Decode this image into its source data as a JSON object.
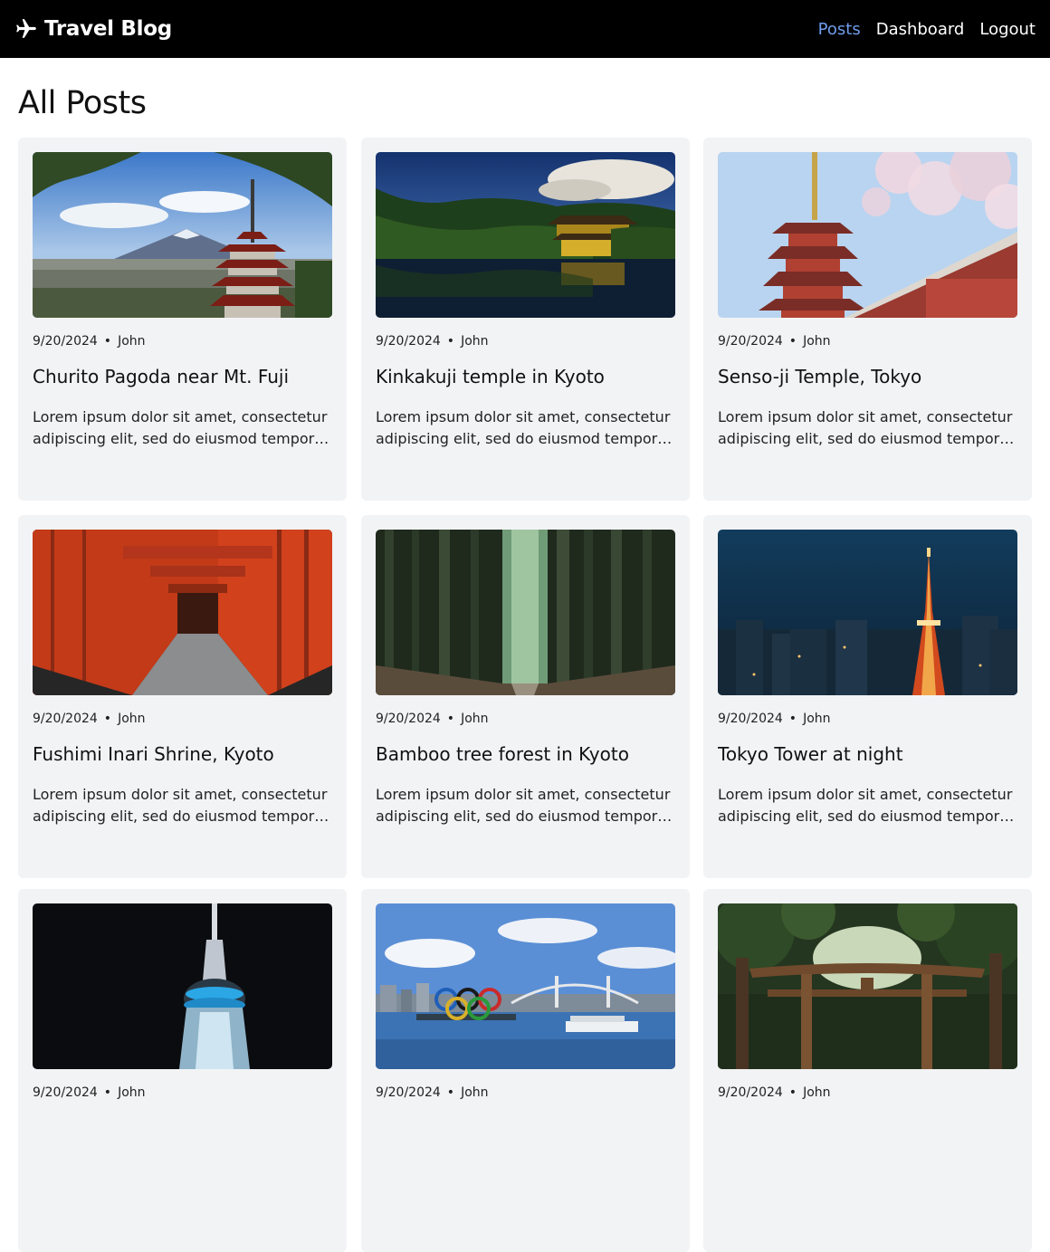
{
  "nav": {
    "brand": "Travel Blog",
    "brand_icon": "airplane-icon",
    "links": [
      {
        "label": "Posts",
        "active": true
      },
      {
        "label": "Dashboard",
        "active": false
      },
      {
        "label": "Logout",
        "active": false
      }
    ],
    "active_color": "#6f9dec"
  },
  "page": {
    "title": "All Posts"
  },
  "posts": [
    {
      "date": "9/20/2024",
      "author": "John",
      "title": "Churito Pagoda near Mt. Fuji",
      "excerpt": "Lorem ipsum dolor sit amet, consectetur adipiscing elit, sed do eiusmod tempor incididunt ut labore et dolore magna aliqua.",
      "image": "pagoda-mt-fuji-photo"
    },
    {
      "date": "9/20/2024",
      "author": "John",
      "title": "Kinkakuji temple in Kyoto",
      "excerpt": "Lorem ipsum dolor sit amet, consectetur adipiscing elit, sed do eiusmod tempor incididunt ut labore et dolore magna aliqua.",
      "image": "golden-temple-photo"
    },
    {
      "date": "9/20/2024",
      "author": "John",
      "title": "Senso-ji Temple, Tokyo",
      "excerpt": "Lorem ipsum dolor sit amet, consectetur adipiscing elit, sed do eiusmod tempor incididunt ut labore et dolore magna aliqua.",
      "image": "senso-ji-photo"
    },
    {
      "date": "9/20/2024",
      "author": "John",
      "title": "Fushimi Inari Shrine, Kyoto",
      "excerpt": "Lorem ipsum dolor sit amet, consectetur adipiscing elit, sed do eiusmod tempor incididunt ut labore et dolore magna aliqua.",
      "image": "torii-gates-photo"
    },
    {
      "date": "9/20/2024",
      "author": "John",
      "title": "Bamboo tree forest in Kyoto",
      "excerpt": "Lorem ipsum dolor sit amet, consectetur adipiscing elit, sed do eiusmod tempor incididunt ut labore et dolore magna aliqua.",
      "image": "bamboo-forest-photo"
    },
    {
      "date": "9/20/2024",
      "author": "John",
      "title": "Tokyo Tower at night",
      "excerpt": "Lorem ipsum dolor sit amet, consectetur adipiscing elit, sed do eiusmod tempor incididunt ut labore et dolore magna aliqua.",
      "image": "tokyo-tower-photo"
    },
    {
      "date": "9/20/2024",
      "author": "John",
      "title": "",
      "excerpt": "",
      "image": "skytree-photo"
    },
    {
      "date": "9/20/2024",
      "author": "John",
      "title": "",
      "excerpt": "",
      "image": "olympic-rings-bay-photo"
    },
    {
      "date": "9/20/2024",
      "author": "John",
      "title": "",
      "excerpt": "",
      "image": "forest-torii-photo"
    }
  ]
}
